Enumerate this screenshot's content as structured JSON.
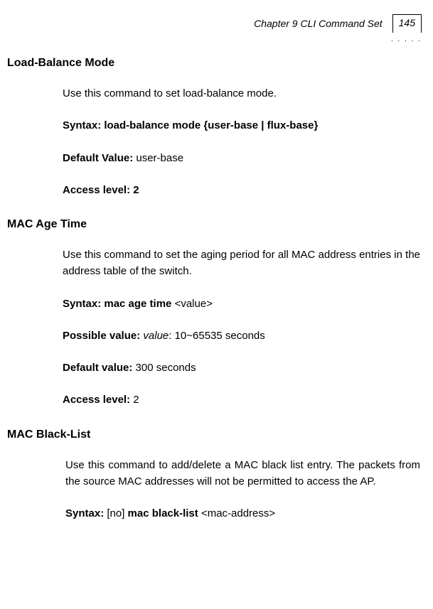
{
  "header": {
    "chapter": "Chapter 9 CLI Command Set",
    "pageNum": "145",
    "dots": ". . . . ."
  },
  "sections": {
    "loadBalance": {
      "heading": "Load-Balance Mode",
      "desc": "Use this command to set load-balance mode.",
      "syntaxLabel": "Syntax: load-balance mode {user-base | flux-base}",
      "defaultLabel": "Default Value: ",
      "defaultValue": "user-base",
      "accessLabel": "Access level: 2"
    },
    "macAge": {
      "heading": "MAC Age Time",
      "desc": "Use this command to set the aging period for all MAC address entries in the address table of the switch.",
      "syntaxLabel": "Syntax: mac age time ",
      "syntaxArg": "<value>",
      "possibleLabel": "Possible value: ",
      "possibleItalic": "value",
      "possibleRest": ": 10~65535 seconds",
      "defaultLabel": "Default value: ",
      "defaultValue": "300 seconds",
      "accessLabel": "Access level: ",
      "accessValue": "2"
    },
    "macBlack": {
      "heading": "MAC Black-List",
      "desc": "Use this command to add/delete a MAC black list entry. The packets from the source MAC addresses will not be permitted to access the AP.",
      "syntaxLabel": "Syntax: ",
      "syntaxPre": "[no] ",
      "syntaxBold": "mac black-list ",
      "syntaxArg": "<mac-address>"
    }
  }
}
